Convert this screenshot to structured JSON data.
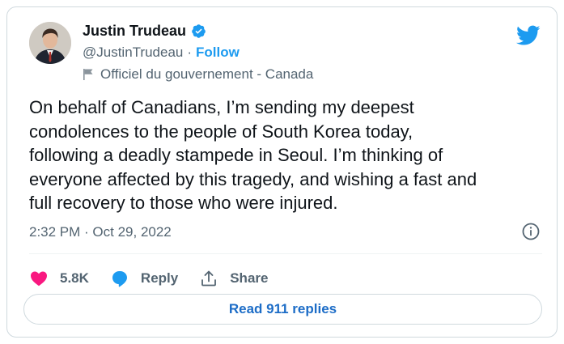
{
  "author": {
    "name": "Justin Trudeau",
    "handle": "@JustinTrudeau",
    "separator": "·",
    "follow_label": "Follow",
    "gov_label": "Officiel du gouvernement - Canada"
  },
  "tweet": {
    "text": "On behalf of Canadians, I’m sending my deepest\ncondolences to the people of South Korea today,\nfollowing a deadly stampede in Seoul. I’m thinking of\neveryone affected by this tragedy, and wishing a fast and\nfull recovery to those who were injured.",
    "timestamp": "2:32 PM · Oct 29, 2022"
  },
  "actions": {
    "likes": "5.8K",
    "reply_label": "Reply",
    "share_label": "Share"
  },
  "replies_button": "Read 911 replies",
  "colors": {
    "accent": "#1d9bf0",
    "heart": "#f91880",
    "muted": "#536471",
    "border": "#cfd9de"
  },
  "icons": [
    "verified-badge-icon",
    "flag-icon",
    "twitter-bird-icon",
    "info-icon",
    "heart-icon",
    "reply-bubble-icon",
    "share-icon"
  ]
}
